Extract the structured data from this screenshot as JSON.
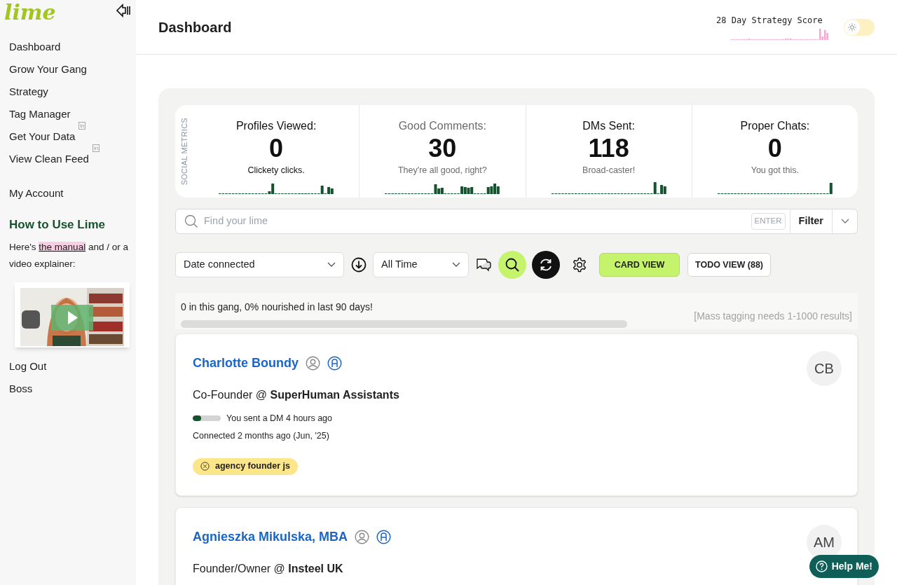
{
  "sidebar": {
    "logo": "lime",
    "nav": [
      {
        "label": "Dashboard"
      },
      {
        "label": "Grow Your Gang"
      },
      {
        "label": "Strategy"
      },
      {
        "label": "Tag Manager"
      },
      {
        "label": "Get Your Data",
        "tag": "in"
      },
      {
        "label": "View Clean Feed",
        "tag": "in"
      }
    ],
    "account": "My Account",
    "help": {
      "title": "How to Use Lime",
      "text_before": "Here's",
      "link": "the manual",
      "text_after": "and / or a video explainer:"
    },
    "bottom": [
      {
        "label": "Log Out"
      },
      {
        "label": "Boss"
      }
    ]
  },
  "header": {
    "title": "Dashboard",
    "score_label": "28 Day Strategy Score",
    "dark_mode": false
  },
  "metrics_label": "SOCIAL METRICS",
  "metrics": [
    {
      "title": "Profiles Viewed:",
      "value": "0",
      "caption": "Clickety clicks.",
      "title_muted": false,
      "caption_muted": false
    },
    {
      "title": "Good Comments:",
      "value": "30",
      "caption": "They're all good, right?",
      "title_muted": true,
      "caption_muted": true
    },
    {
      "title": "DMs Sent:",
      "value": "118",
      "caption": "Broad-caster!",
      "title_muted": false,
      "caption_muted": true
    },
    {
      "title": "Proper Chats:",
      "value": "0",
      "caption": "You got this.",
      "title_muted": false,
      "caption_muted": true
    }
  ],
  "search": {
    "placeholder": "Find your lime",
    "enter_hint": "ENTER",
    "filter": "Filter"
  },
  "controls": {
    "sort": "Date connected",
    "range": "All Time",
    "views": [
      {
        "label": "CARD VIEW",
        "selected": true
      },
      {
        "label": "TODO VIEW (88)",
        "selected": false
      }
    ]
  },
  "summary": {
    "text": "0 in this gang, 0% nourished in last 90 days!",
    "level": 0,
    "note": "[Mass tagging needs 1-1000 results]"
  },
  "contacts": [
    {
      "name": "Charlotte Boundy",
      "role": "Co-Founder @ **SuperHuman Assistants**",
      "initials": "CB",
      "activity": "You sent a DM 4 hours ago",
      "level": 0.3,
      "connected": "Connected 2 months ago (Jun, '25)",
      "tags": [
        "agency founder js"
      ]
    },
    {
      "name": "Agnieszka Mikulska, MBA",
      "role": "Founder/Owner @ **Insteel UK**",
      "initials": "AM"
    }
  ],
  "help_button": "Help Me!"
}
